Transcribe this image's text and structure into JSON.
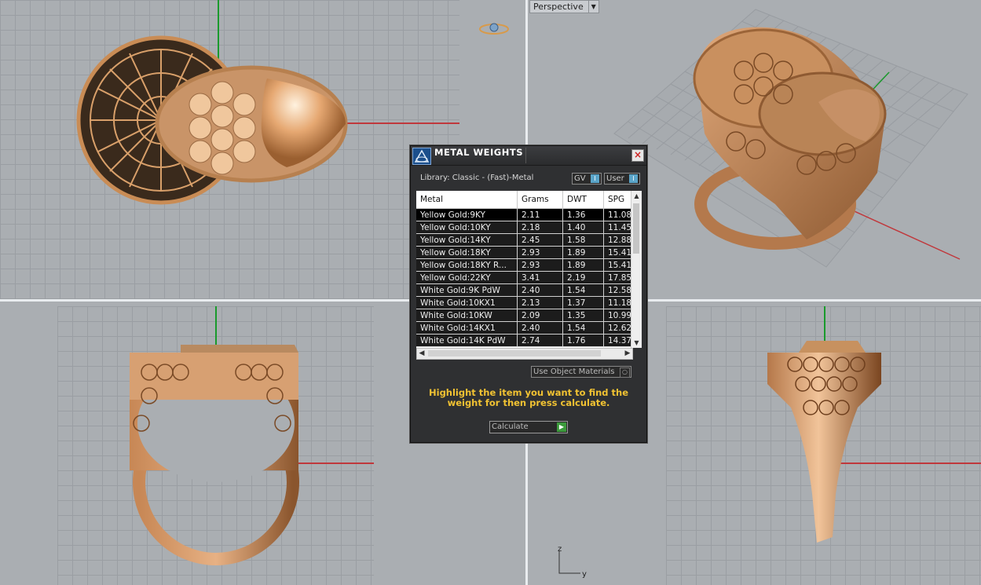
{
  "viewports": {
    "perspective_label": "Perspective"
  },
  "dialog": {
    "title": "METAL WEIGHTS",
    "library_label": "Library: Classic - (Fast)-Metal",
    "toggle_gv": "GV",
    "toggle_user": "User",
    "columns": [
      "Metal",
      "Grams",
      "DWT",
      "SPG"
    ],
    "rows": [
      [
        "Yellow Gold:9KY",
        "2.11",
        "1.36",
        "11.08"
      ],
      [
        "Yellow Gold:10KY",
        "2.18",
        "1.40",
        "11.45"
      ],
      [
        "Yellow Gold:14KY",
        "2.45",
        "1.58",
        "12.88"
      ],
      [
        "Yellow Gold:18KY",
        "2.93",
        "1.89",
        "15.41"
      ],
      [
        "Yellow Gold:18KY R...",
        "2.93",
        "1.89",
        "15.41"
      ],
      [
        "Yellow Gold:22KY",
        "3.41",
        "2.19",
        "17.85"
      ],
      [
        "White Gold:9K PdW",
        "2.40",
        "1.54",
        "12.58"
      ],
      [
        "White Gold:10KX1",
        "2.13",
        "1.37",
        "11.18"
      ],
      [
        "White Gold:10KW",
        "2.09",
        "1.35",
        "10.99"
      ],
      [
        "White Gold:14KX1",
        "2.40",
        "1.54",
        "12.62"
      ],
      [
        "White Gold:14K PdW",
        "2.74",
        "1.76",
        "14.37"
      ]
    ],
    "use_object_materials": "Use Object Materials",
    "hint": "Highlight the item you want to find the weight for then press calculate.",
    "calculate": "Calculate"
  },
  "axes": {
    "z": "z",
    "y": "y"
  },
  "icons": [
    "metal-weights-logo-icon",
    "close-icon",
    "gv-toggle-icon",
    "user-toggle-icon",
    "checkbox-icon",
    "play-icon",
    "scroll-up-icon",
    "scroll-down-icon",
    "scroll-left-icon",
    "scroll-right-icon",
    "ring-view-icon"
  ],
  "colors": {
    "gold": "#d9a06a",
    "hint": "#f1c232",
    "dialog_bg": "#2f3032",
    "axis_green": "#1a9a2c",
    "axis_red": "#c0383c"
  }
}
